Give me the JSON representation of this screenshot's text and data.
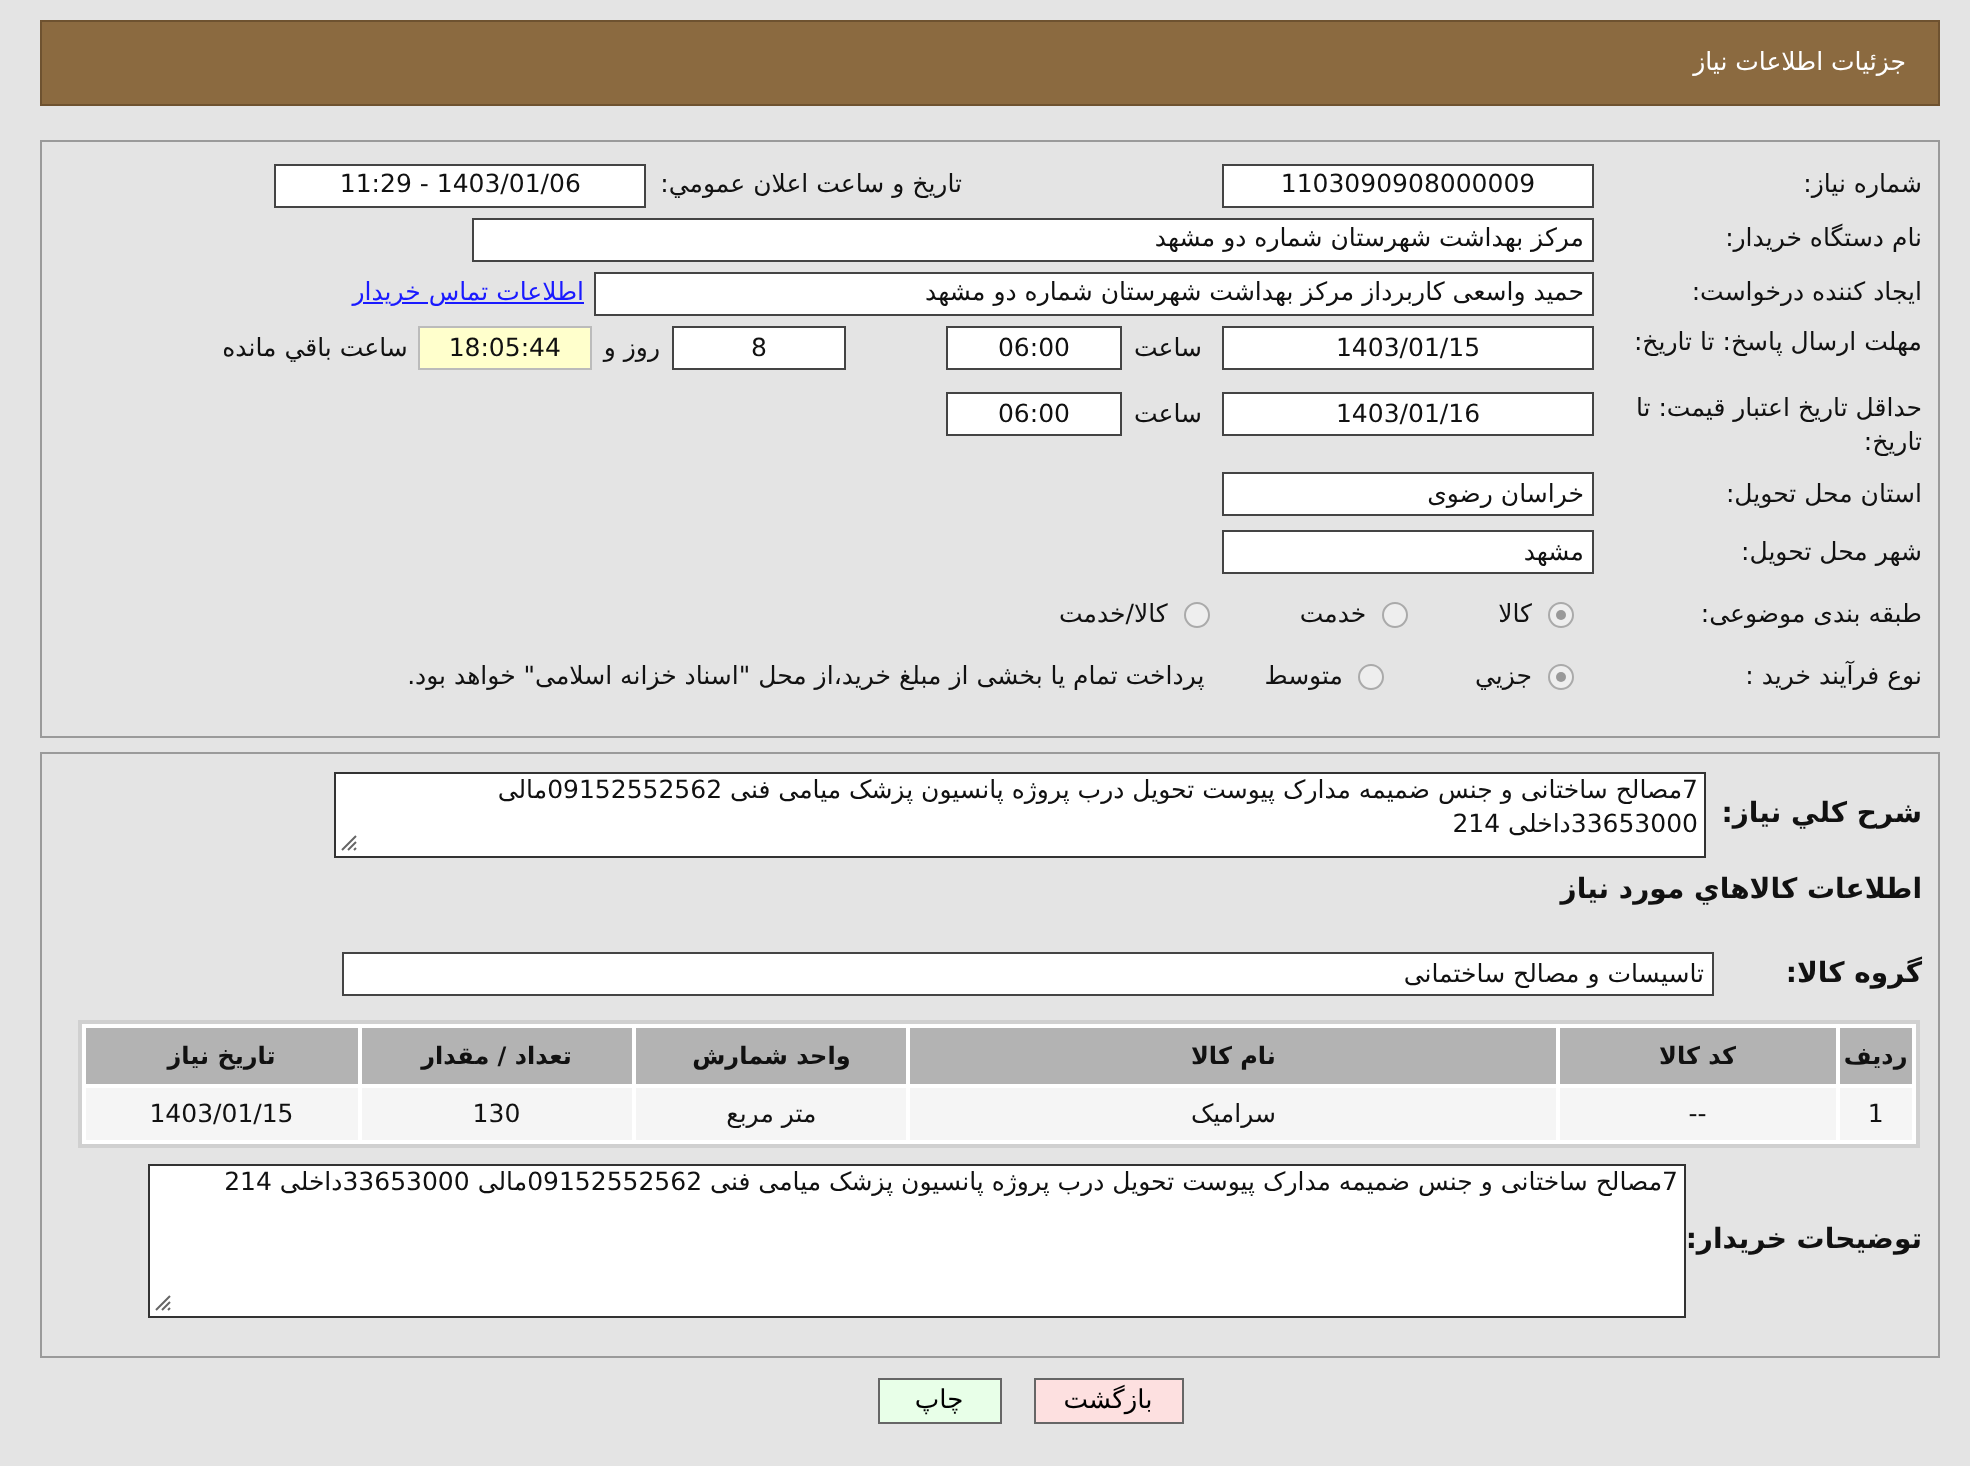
{
  "header": {
    "title": "جزئیات اطلاعات نیاز"
  },
  "details": {
    "need_number": {
      "label": "شماره نیاز:",
      "value": "1103090908000009"
    },
    "announce": {
      "label": "تاریخ و ساعت اعلان عمومي:",
      "value": "1403/01/06 - 11:29"
    },
    "buyer_org": {
      "label": "نام دستگاه خریدار:",
      "value": "مرکز بهداشت شهرستان شماره دو مشهد"
    },
    "requester": {
      "label": "ایجاد کننده درخواست:",
      "value": "حمید واسعی کاربرداز مرکز بهداشت شهرستان شماره دو مشهد",
      "link": "اطلاعات تماس خریدار"
    },
    "deadline": {
      "label": "مهلت ارسال پاسخ: تا تاریخ:",
      "date": "1403/01/15",
      "time_label": "ساعت",
      "time": "06:00",
      "days": "8",
      "days_label": "روز و",
      "remaining": "18:05:44",
      "remaining_label": "ساعت باقي مانده"
    },
    "validity": {
      "label": "حداقل تاریخ اعتبار قیمت: تا تاریخ:",
      "date": "1403/01/16",
      "time_label": "ساعت",
      "time": "06:00"
    },
    "province": {
      "label": "استان محل تحویل:",
      "value": "خراسان رضوی"
    },
    "city": {
      "label": "شهر محل تحویل:",
      "value": "مشهد"
    },
    "category": {
      "label": "طبقه بندی موضوعی:",
      "options": [
        {
          "label": "کالا",
          "selected": true
        },
        {
          "label": "خدمت",
          "selected": false
        },
        {
          "label": "کالا/خدمت",
          "selected": false
        }
      ]
    },
    "process": {
      "label": "نوع فرآیند خرید :",
      "options": [
        {
          "label": "جزيي",
          "selected": true
        },
        {
          "label": "متوسط",
          "selected": false
        }
      ],
      "note": "پرداخت تمام یا بخشی از مبلغ خرید،از محل \"اسناد خزانه اسلامی\" خواهد بود."
    }
  },
  "goods": {
    "summary": {
      "label": "شرح کلي نیاز:",
      "value": "7مصالح ساختانی و جنس ضمیمه مدارک پیوست  تحویل درب پروژه پانسیون پزشک میامی فنی 09152552562مالی 33653000داخلی 214"
    },
    "heading": "اطلاعات کالاهاي مورد نیاز",
    "group": {
      "label": "گروه کالا:",
      "value": "تاسیسات و مصالح ساختمانی"
    },
    "table": {
      "columns": [
        "ردیف",
        "کد کالا",
        "نام کالا",
        "واحد شمارش",
        "تعداد / مقدار",
        "تاریخ نیاز"
      ],
      "rows": [
        [
          "1",
          "--",
          "سرامیک",
          "متر مربع",
          "130",
          "1403/01/15"
        ]
      ]
    },
    "buyer_notes": {
      "label": "توضیحات خریدار:",
      "value": "7مصالح ساختانی و جنس ضمیمه مدارک پیوست  تحویل درب پروژه پانسیون پزشک میامی فنی 09152552562مالی 33653000داخلی 214"
    }
  },
  "buttons": [
    {
      "label": "بازگشت",
      "kind": "back"
    },
    {
      "label": "چاپ",
      "kind": "print"
    }
  ]
}
